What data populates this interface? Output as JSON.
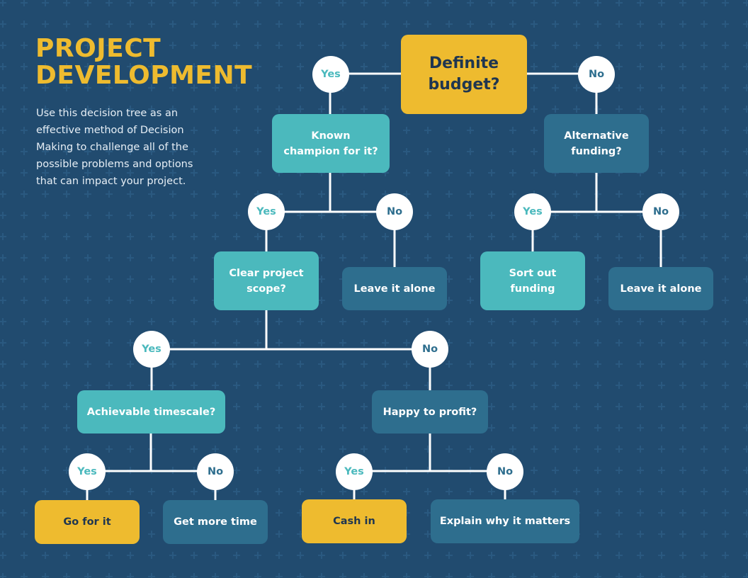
{
  "header": {
    "title_line1": "PROJECT",
    "title_line2": "DEVELOPMENT",
    "description": "Use this decision tree as an effective method of Decision Making to challenge all of the possible problems and options that can impact your project."
  },
  "colors": {
    "background": "#214b6f",
    "pattern": "#2a5980",
    "accent_gold": "#eebb2f",
    "teal": "#4bb9bd",
    "steel_blue": "#2e6e8e",
    "dark_text": "#1f3650",
    "line": "#ffffff"
  },
  "labels": {
    "yes": "Yes",
    "no": "No"
  },
  "nodes": {
    "root": {
      "line1": "Definite",
      "line2": "budget?"
    },
    "known_champion": {
      "line1": "Known",
      "line2": "champion for it?"
    },
    "alternative_funding": {
      "line1": "Alternative",
      "line2": "funding?"
    },
    "clear_scope": {
      "line1": "Clear project",
      "line2": "scope?"
    },
    "leave_alone_1": {
      "text": "Leave it alone"
    },
    "sort_funding": {
      "line1": "Sort out",
      "line2": "funding"
    },
    "leave_alone_2": {
      "text": "Leave it alone"
    },
    "achievable_timescale": {
      "text": "Achievable timescale?"
    },
    "happy_profit": {
      "text": "Happy to profit?"
    },
    "go_for_it": {
      "text": "Go for it"
    },
    "more_time": {
      "text": "Get more time"
    },
    "cash_in": {
      "text": "Cash in"
    },
    "explain": {
      "text": "Explain why it matters"
    }
  }
}
